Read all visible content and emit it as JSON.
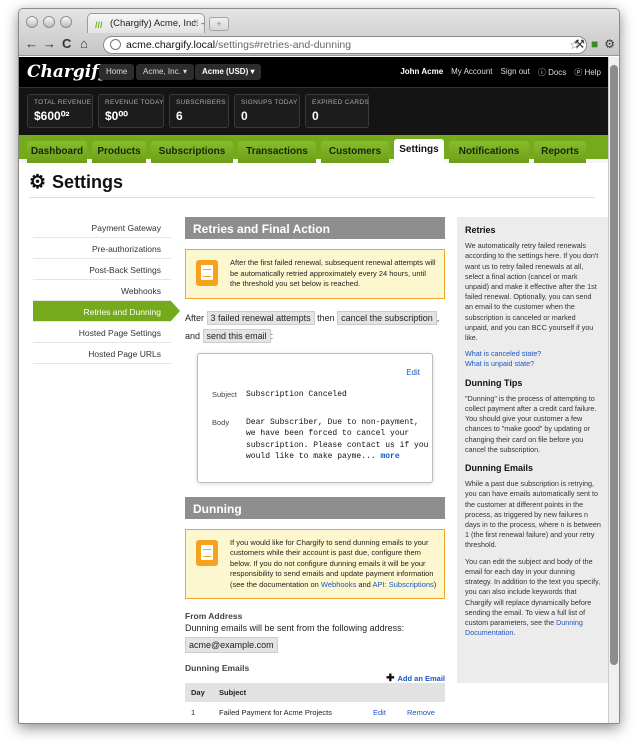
{
  "browser": {
    "tab_title": "(Chargify) Acme, Inc. — Acme",
    "url_domain": "acme.chargify.local",
    "url_path": "/settings#retries-and-dunning"
  },
  "topbar": {
    "logo": "Chargify",
    "home": "Home",
    "org": "Acme, Inc. ▾",
    "site": "Acme (USD) ▾",
    "user": "John Acme",
    "my_account": "My Account",
    "sign_out": "Sign out",
    "docs": "ⓘ Docs",
    "help": "ⓟ Help"
  },
  "stats": [
    {
      "label": "TOTAL REVENUE",
      "value": "$600⁰²"
    },
    {
      "label": "REVENUE TODAY",
      "value": "$0⁰⁰"
    },
    {
      "label": "SUBSCRIBERS",
      "value": "6"
    },
    {
      "label": "SIGNUPS TODAY",
      "value": "0"
    },
    {
      "label": "EXPIRED CARDS",
      "value": "0"
    }
  ],
  "nav_tabs": [
    "Dashboard",
    "Products",
    "Subscriptions",
    "Transactions",
    "Customers",
    "Settings",
    "Notifications",
    "Reports"
  ],
  "page_title": "Settings",
  "sidebar": [
    "Payment Gateway",
    "Pre-authorizations",
    "Post-Back Settings",
    "Webhooks",
    "Retries and Dunning",
    "Hosted Page Settings",
    "Hosted Page URLs"
  ],
  "retries": {
    "heading": "Retries and Final Action",
    "note": "After the first failed renewal, subsequent renewal attempts will be automatically retried approximately every 24 hours, until the threshold you set below is reached.",
    "after_1": "After",
    "attempts": "3 failed renewal attempts",
    "then": "then",
    "action": "cancel the subscription",
    "and": ", and",
    "send": "send this email",
    "colon": ":",
    "edit": "Edit",
    "subject_label": "Subject",
    "subject": "Subscription Canceled",
    "body_label": "Body",
    "body": "Dear Subscriber, Due to non-payment, we have been forced to cancel your subscription. Please contact us if you would like to make payme...",
    "more": "more"
  },
  "dunning": {
    "heading": "Dunning",
    "note": "If you would like for Chargify to send dunning emails to your customers while their account is past due, configure them below. If you do not configure dunning emails it will be your responsibility to send emails and update payment information (see the documentation on",
    "note_link1": "Webhooks",
    "note_and": "and",
    "note_link2": "API: Subscriptions",
    "note_end": ")",
    "from_label": "From Address",
    "from_text": "Dunning emails will be sent from the following address:",
    "from_addr": "acme@example.com",
    "emails_label": "Dunning Emails",
    "add_email": "Add an Email",
    "col_day": "Day",
    "col_subject": "Subject",
    "rows": [
      {
        "day": "1",
        "subject": "Failed Payment for Acme Projects",
        "edit": "Edit",
        "remove": "Remove"
      }
    ]
  },
  "aside": {
    "retries_h": "Retries",
    "retries_p": "We automatically retry failed renewals according to the settings here. If you don't want us to retry failed renewals at all, select a final action (cancel or mark unpaid) and make it effective after the 1st failed renewal. Optionally, you can send an email to the customer when the subscription is canceled or marked unpaid, and you can BCC yourself if you like.",
    "link1": "What is canceled state?",
    "link2": "What is unpaid state?",
    "tips_h": "Dunning Tips",
    "tips_p": "\"Dunning\" is the process of attempting to collect payment after a credit card failure. You should give your customer a few chances to \"make good\" by updating or changing their card on file before you cancel the subscription.",
    "emails_h": "Dunning Emails",
    "emails_p1": "While a past due subscription is retrying, you can have emails automatically sent to the customer at different points in the process, as triggered by new failures n days in to the process, where n is between 1 (the first renewal failure) and your retry threshold.",
    "emails_p2": "You can edit the subject and body of the email for each day in your dunning strategy. In addition to the text you specify, you can also include keywords that Chargify will replace dynamically before sending the email. To view a full list of custom parameters, see the",
    "emails_link": "Dunning Documentation",
    "emails_end": "."
  }
}
